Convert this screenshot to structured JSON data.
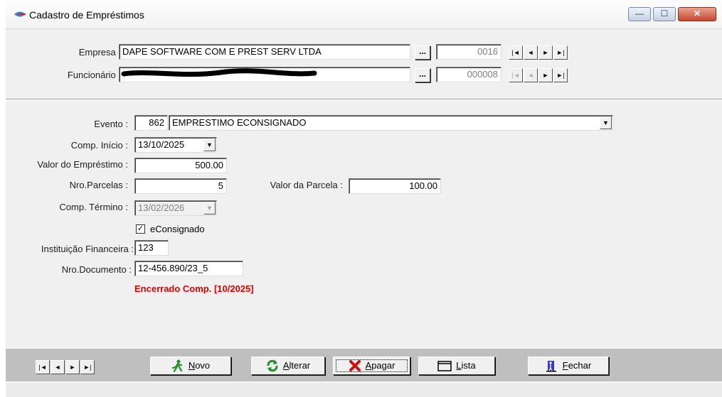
{
  "window": {
    "title": "Cadastro de Empréstimos",
    "controls": {
      "minimize": "—",
      "maximize": "☐",
      "close": "✕"
    }
  },
  "empresa": {
    "label": "Empresa :",
    "value": "DAPE SOFTWARE COM E PREST SERV LTDA",
    "browse": "...",
    "code": "0016"
  },
  "funcionario": {
    "label": "Funcionário :",
    "value": "",
    "browse": "...",
    "code": "000008"
  },
  "nav": {
    "first": "|◄",
    "prev": "◄",
    "next": "►",
    "last": "►|"
  },
  "form": {
    "evento": {
      "label": "Evento :",
      "code": "862",
      "value": "EMPRESTIMO ECONSIGNADO"
    },
    "comp_inicio": {
      "label": "Comp. Início :",
      "value": "13/10/2025"
    },
    "valor_emprestimo": {
      "label": "Valor do Empréstimo :",
      "value": "500.00"
    },
    "nro_parcelas": {
      "label": "Nro.Parcelas :",
      "value": "5"
    },
    "valor_parcela": {
      "label": "Valor da Parcela :",
      "value": "100.00"
    },
    "comp_termino": {
      "label": "Comp. Término :",
      "value": "13/02/2026"
    },
    "econsignado": {
      "label": "eConsignado",
      "checked": true
    },
    "instituicao": {
      "label": "Instituição Financeira :",
      "value": "123"
    },
    "nro_documento": {
      "label": "Nro.Documento :",
      "value": "12-456.890/23_5"
    },
    "status_message": "Encerrado Comp. [10/2025]"
  },
  "toolbar": {
    "novo_key": "N",
    "novo_rest": "ovo",
    "alterar_key": "A",
    "alterar_rest": "lterar",
    "apagar_key": "A",
    "apagar_rest": "pagar",
    "lista_key": "L",
    "lista_rest": "ista",
    "fechar_key": "F",
    "fechar_rest": "echar"
  },
  "colors": {
    "warning": "#e00000",
    "toolbar_bg": "#bfbfbf",
    "redaction": "#000000"
  }
}
